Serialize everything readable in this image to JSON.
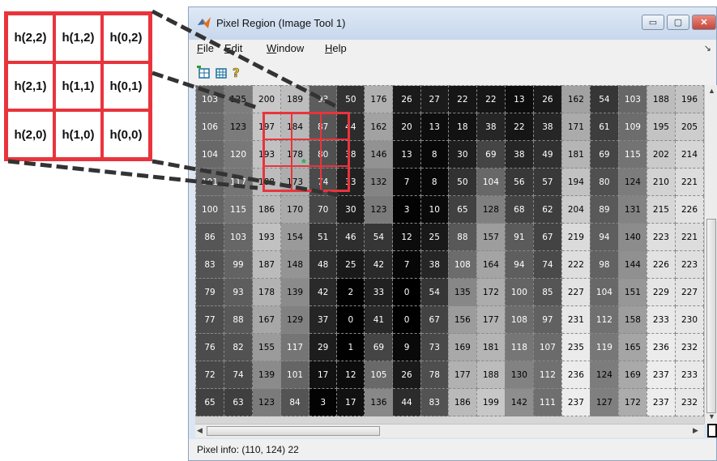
{
  "kernel": {
    "cells": [
      "h(2,2)",
      "h(1,2)",
      "h(0,2)",
      "h(2,1)",
      "h(1,1)",
      "h(0,1)",
      "h(2,0)",
      "h(1,0)",
      "h(0,0)"
    ]
  },
  "window": {
    "title": "Pixel Region (Image Tool 1)",
    "controls": {
      "minimize": "▭",
      "maximize": "▢",
      "close": "✕"
    }
  },
  "menu": {
    "file": "File",
    "edit": "Edit",
    "window": "Window",
    "help": "Help"
  },
  "toolbar": {
    "icons": [
      "insert-table-icon",
      "table-icon",
      "help-icon"
    ]
  },
  "pixel_grid": {
    "rows": [
      [
        "103",
        "125",
        "200",
        "189",
        "93",
        "50",
        "176",
        "26",
        "27",
        "22",
        "22",
        "13",
        "26",
        "162",
        "54",
        "103",
        "188",
        "196"
      ],
      [
        "106",
        "123",
        "197",
        "184",
        "87",
        "44",
        "162",
        "20",
        "13",
        "18",
        "38",
        "22",
        "38",
        "171",
        "61",
        "109",
        "195",
        "205"
      ],
      [
        "104",
        "120",
        "193",
        "178",
        "80",
        "38",
        "146",
        "13",
        "8",
        "30",
        "69",
        "38",
        "49",
        "181",
        "69",
        "115",
        "202",
        "214"
      ],
      [
        "101",
        "117",
        "188",
        "173",
        "74",
        "33",
        "132",
        "7",
        "8",
        "50",
        "104",
        "56",
        "57",
        "194",
        "80",
        "124",
        "210",
        "221"
      ],
      [
        "100",
        "115",
        "186",
        "170",
        "70",
        "30",
        "123",
        "3",
        "10",
        "65",
        "128",
        "68",
        "62",
        "204",
        "89",
        "131",
        "215",
        "226"
      ],
      [
        "86",
        "103",
        "193",
        "154",
        "51",
        "46",
        "54",
        "12",
        "25",
        "88",
        "157",
        "91",
        "67",
        "219",
        "94",
        "140",
        "223",
        "221"
      ],
      [
        "83",
        "99",
        "187",
        "148",
        "48",
        "25",
        "42",
        "7",
        "38",
        "108",
        "164",
        "94",
        "74",
        "222",
        "98",
        "144",
        "226",
        "223"
      ],
      [
        "79",
        "93",
        "178",
        "139",
        "42",
        "2",
        "33",
        "0",
        "54",
        "135",
        "172",
        "100",
        "85",
        "227",
        "104",
        "151",
        "229",
        "227"
      ],
      [
        "77",
        "88",
        "167",
        "129",
        "37",
        "0",
        "41",
        "0",
        "67",
        "156",
        "177",
        "108",
        "97",
        "231",
        "112",
        "158",
        "233",
        "230"
      ],
      [
        "76",
        "82",
        "155",
        "117",
        "29",
        "1",
        "69",
        "9",
        "73",
        "169",
        "181",
        "118",
        "107",
        "235",
        "119",
        "165",
        "236",
        "232"
      ],
      [
        "72",
        "74",
        "139",
        "101",
        "17",
        "12",
        "105",
        "26",
        "78",
        "177",
        "188",
        "130",
        "112",
        "236",
        "124",
        "169",
        "237",
        "233"
      ],
      [
        "65",
        "63",
        "123",
        "84",
        "3",
        "17",
        "136",
        "44",
        "83",
        "186",
        "199",
        "142",
        "111",
        "237",
        "127",
        "172",
        "237",
        "232"
      ]
    ]
  },
  "status": {
    "pixel_info": "Pixel info: (110, 124)  22"
  },
  "colors": {
    "kernel_border": "#e8343c",
    "star": "#22b04a"
  }
}
